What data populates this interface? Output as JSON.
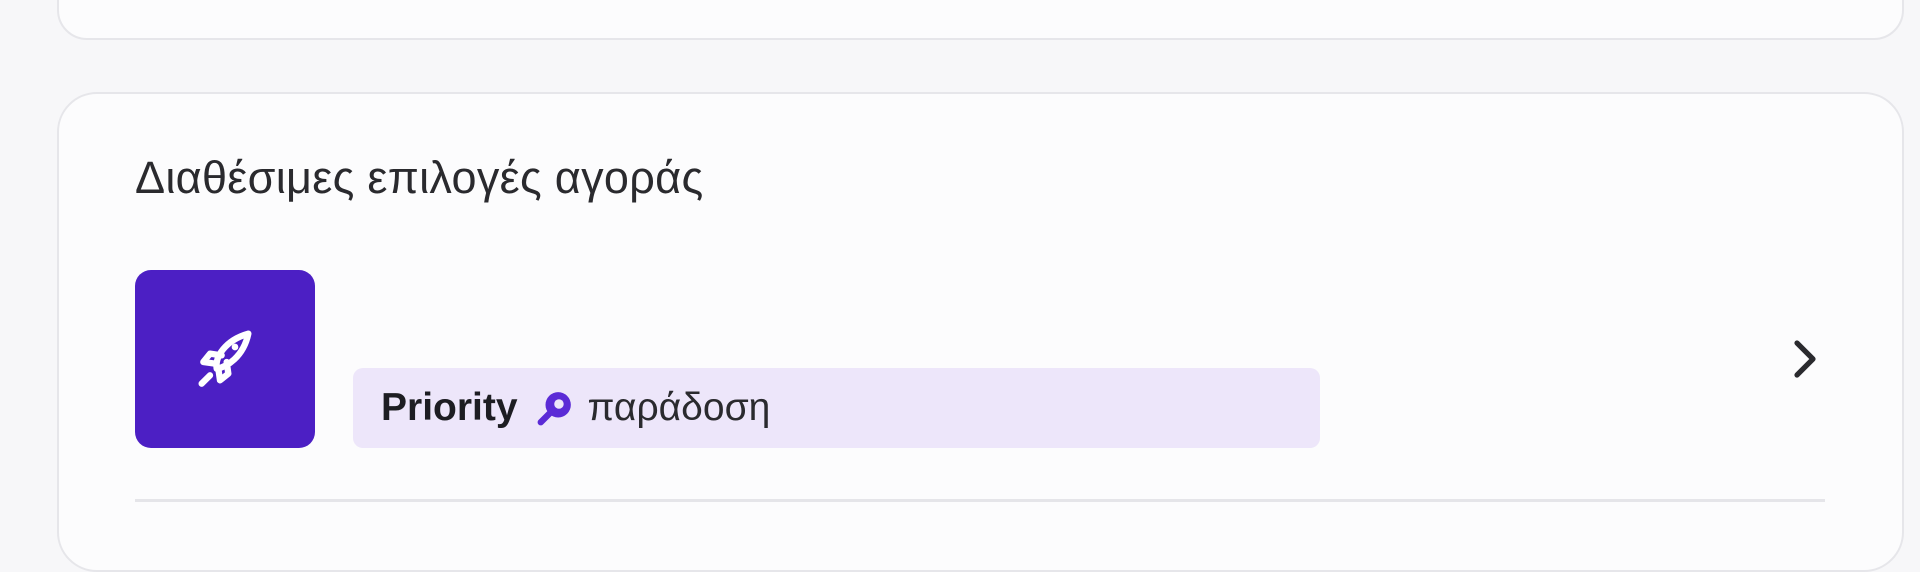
{
  "purchase_options": {
    "title": "Διαθέσιμες επιλογές αγοράς",
    "items": [
      {
        "icon": "rocket-icon",
        "badge_strong": "Priority",
        "badge_icon": "priority-rocket-icon",
        "badge_text": "παράδοση",
        "chevron_icon": "chevron-right-icon"
      }
    ]
  },
  "colors": {
    "tile_background": "#4c1fc4",
    "badge_background": "#ede6fa",
    "badge_icon": "#5b2bd6",
    "text": "#2a2a2e"
  }
}
